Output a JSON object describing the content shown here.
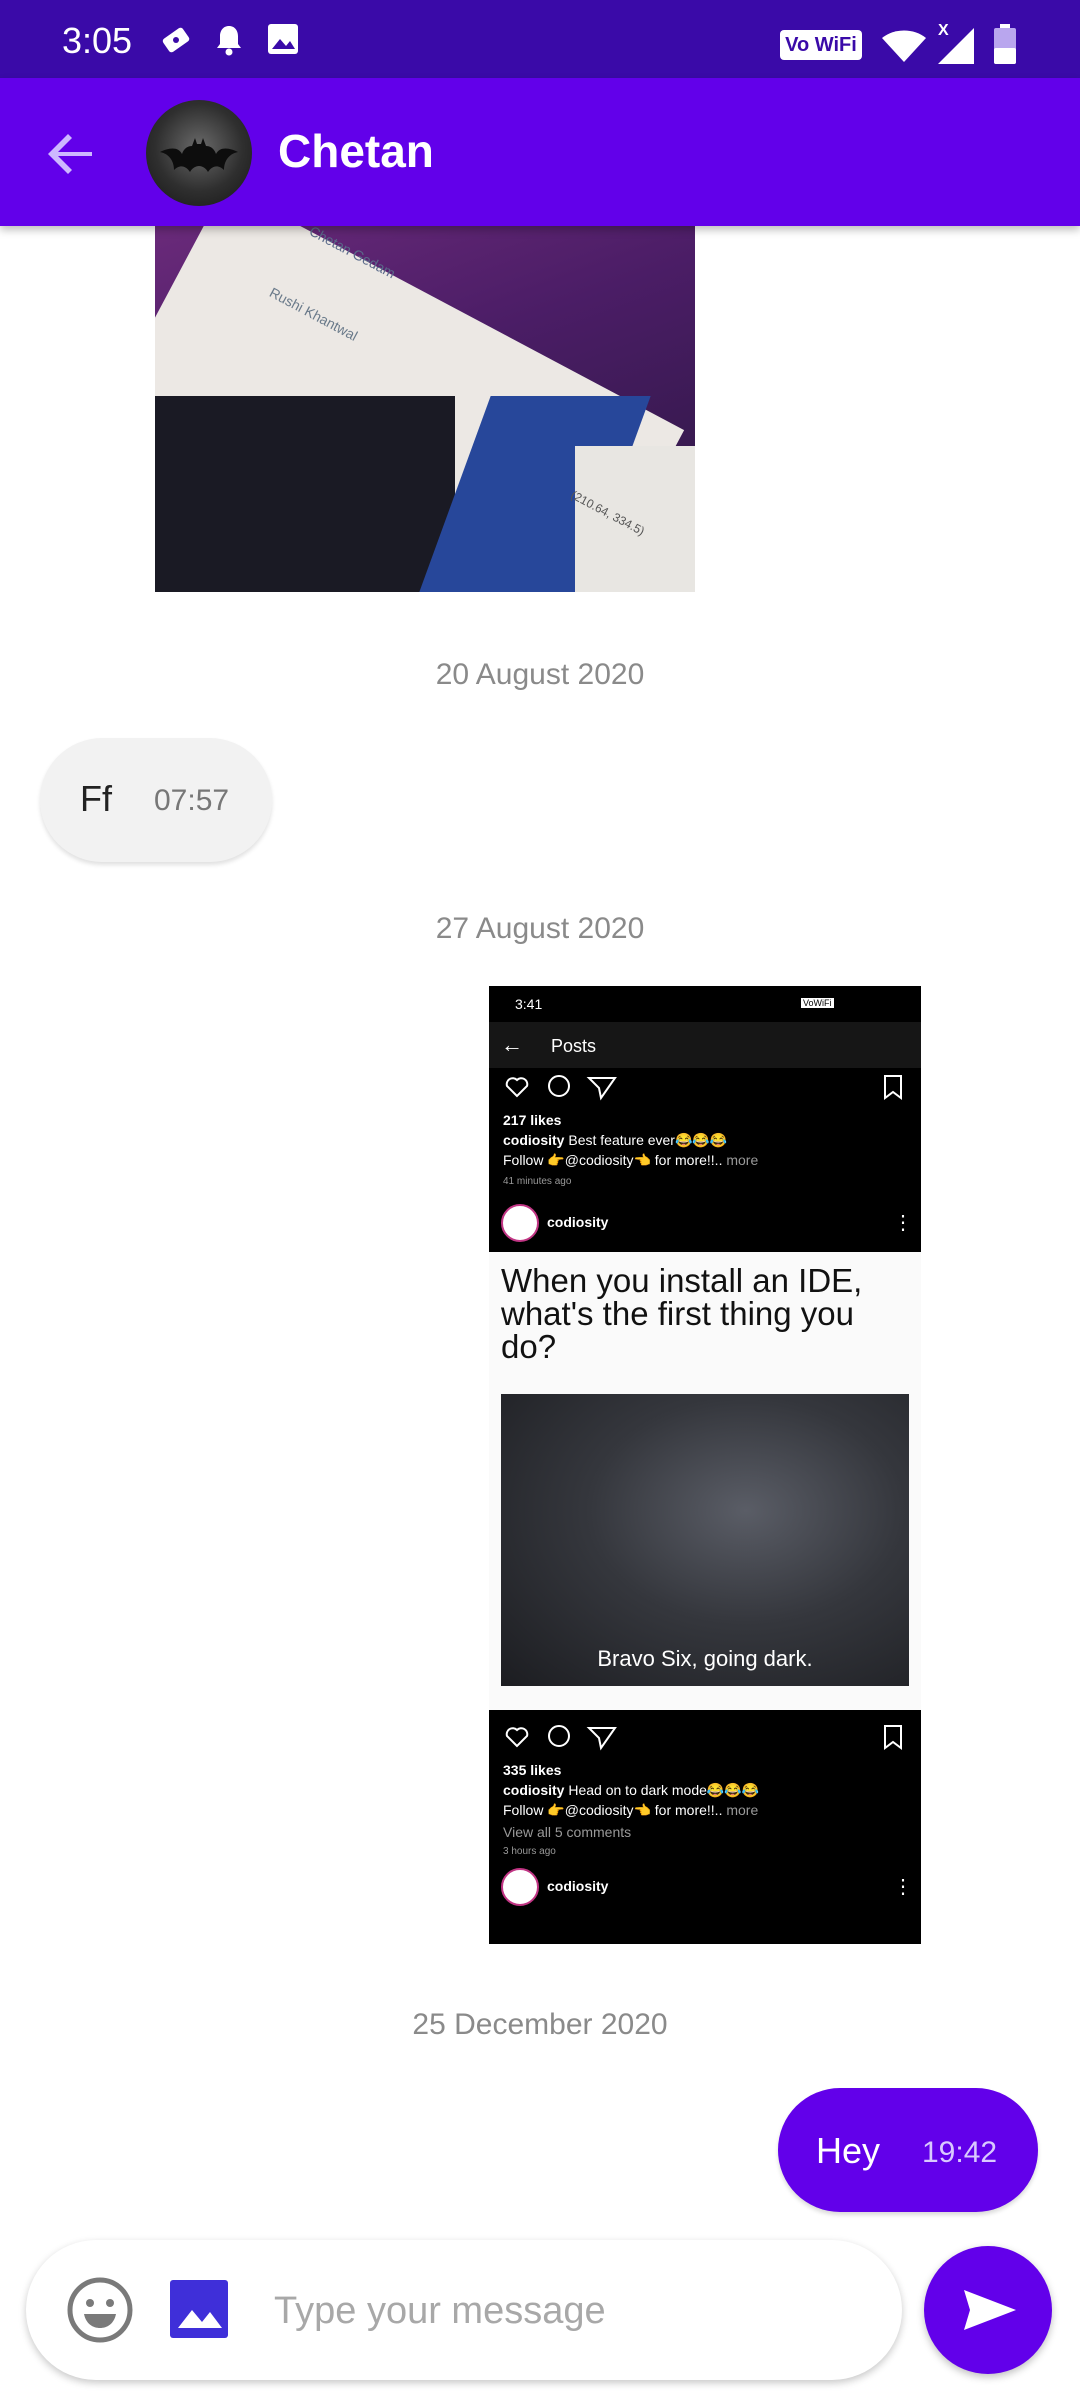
{
  "status_bar": {
    "time": "3:05",
    "network_label": "Vo WiFi",
    "network_badge": "X",
    "icons": [
      "app-notification-icon",
      "bell-icon",
      "image-icon",
      "wifi-icon",
      "signal-icon",
      "battery-icon"
    ]
  },
  "app_bar": {
    "contact_name": "Chetan",
    "back_icon": "arrow-left-icon",
    "avatar_icon": "bat-logo"
  },
  "messages": {
    "date_1": "20 August 2020",
    "incoming_text": "Ff",
    "incoming_time": "07:57",
    "date_2": "27 August 2020",
    "date_3": "25 December 2020",
    "outgoing_text": "Hey",
    "outgoing_time": "19:42"
  },
  "photo_1": {
    "name_1": "Chetan Gedam",
    "name_2": "Rushi Khantwal",
    "coords": "(210.64, 334.5)"
  },
  "shared_post": {
    "status_time": "3:41",
    "status_wifi": "VoWiFi",
    "title": "Posts",
    "likes_1": "217 likes",
    "caption_1_user": "codiosity",
    "caption_1_text": "Best feature ever😂😂😂",
    "follow_1": "Follow 👉@codiosity👈 for more!!..",
    "more_1": "more",
    "time_ago_1": "41 minutes ago",
    "username": "codiosity",
    "meme_question": "When you install an IDE, what's the first thing you do?",
    "meme_caption": "Bravo Six, going dark.",
    "likes_2": "335 likes",
    "caption_2_user": "codiosity",
    "caption_2_text": "Head on to dark mode😂😂😂",
    "follow_2": "Follow 👉@codiosity👈 for more!!..",
    "more_2": "more",
    "comments": "View all 5 comments",
    "time_ago_2": "3 hours ago",
    "username_2": "codiosity"
  },
  "composer": {
    "placeholder": "Type your message",
    "emoji_icon": "smiley-icon",
    "gallery_icon": "image-icon",
    "send_icon": "send-icon"
  },
  "colors": {
    "status_bar": "#3a0aa8",
    "app_bar": "#6200ea",
    "accent": "#6200ea",
    "incoming_bubble": "#f2f2f2"
  }
}
